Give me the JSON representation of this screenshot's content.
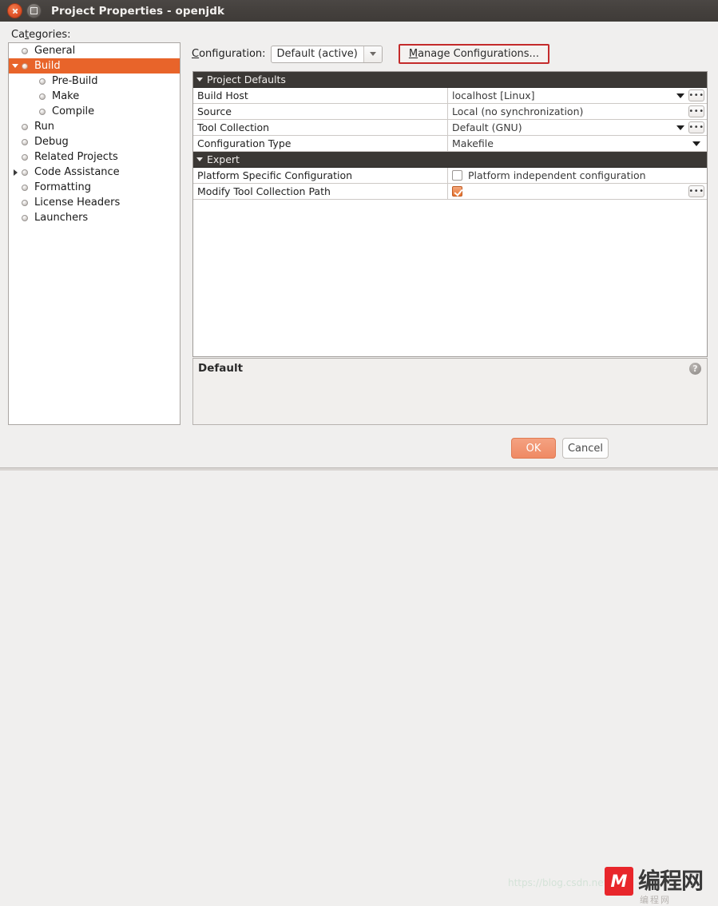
{
  "window": {
    "title": "Project Properties - openjdk",
    "close_icon": "close-icon",
    "maximize_icon": "maximize-icon"
  },
  "sidebar": {
    "label": "Categories:",
    "label_mnemonic": "t",
    "items": [
      {
        "label": "General",
        "depth": 1,
        "twisty": "none",
        "selected": false
      },
      {
        "label": "Build",
        "depth": 1,
        "twisty": "expanded",
        "selected": true
      },
      {
        "label": "Pre-Build",
        "depth": 2,
        "twisty": "none",
        "selected": false
      },
      {
        "label": "Make",
        "depth": 2,
        "twisty": "none",
        "selected": false
      },
      {
        "label": "Compile",
        "depth": 2,
        "twisty": "none",
        "selected": false
      },
      {
        "label": "Run",
        "depth": 1,
        "twisty": "none",
        "selected": false
      },
      {
        "label": "Debug",
        "depth": 1,
        "twisty": "none",
        "selected": false
      },
      {
        "label": "Related Projects",
        "depth": 1,
        "twisty": "none",
        "selected": false
      },
      {
        "label": "Code Assistance",
        "depth": 1,
        "twisty": "collapsed",
        "selected": false
      },
      {
        "label": "Formatting",
        "depth": 1,
        "twisty": "none",
        "selected": false
      },
      {
        "label": "License Headers",
        "depth": 1,
        "twisty": "none",
        "selected": false
      },
      {
        "label": "Launchers",
        "depth": 1,
        "twisty": "none",
        "selected": false
      }
    ]
  },
  "configuration": {
    "label": "Configuration:",
    "label_mnemonic": "C",
    "value": "Default (active)",
    "dropdown_icon": "chevron-down-icon",
    "manage_button": "Manage Configurations...",
    "manage_button_mnemonic": "M",
    "manage_button_highlight_color": "#c42b2b"
  },
  "properties": {
    "rows": [
      {
        "kind": "group",
        "name": "Project Defaults"
      },
      {
        "kind": "value",
        "name": "Build Host",
        "value": "localhost [Linux]",
        "arrow": true,
        "ellipsis": true,
        "arrow_far": false
      },
      {
        "kind": "value",
        "name": "Source",
        "value": "Local (no synchronization)",
        "arrow": false,
        "ellipsis": true,
        "arrow_far": false
      },
      {
        "kind": "value",
        "name": "Tool Collection",
        "value": "Default (GNU)",
        "arrow": true,
        "ellipsis": true,
        "arrow_far": false
      },
      {
        "kind": "value",
        "name": "Configuration Type",
        "value": "Makefile",
        "arrow": true,
        "ellipsis": false,
        "arrow_far": true
      },
      {
        "kind": "group",
        "name": "Expert"
      },
      {
        "kind": "check",
        "name": "Platform Specific Configuration",
        "check_label": "Platform independent configuration",
        "checked": false,
        "ellipsis": false
      },
      {
        "kind": "check",
        "name": "Modify Tool Collection Path",
        "check_label": "",
        "checked": true,
        "ellipsis": true
      }
    ]
  },
  "description": {
    "title": "Default",
    "help_icon": "help-icon",
    "help_glyph": "?"
  },
  "footer": {
    "ok_label": "OK",
    "cancel_label": "Cancel",
    "ok_color": "#ef8a64"
  },
  "watermarks": {
    "url": "https://blog.csdn.net",
    "site_mark": "编程网",
    "site_mark_glyph": "M",
    "site_sub": "编程网"
  }
}
